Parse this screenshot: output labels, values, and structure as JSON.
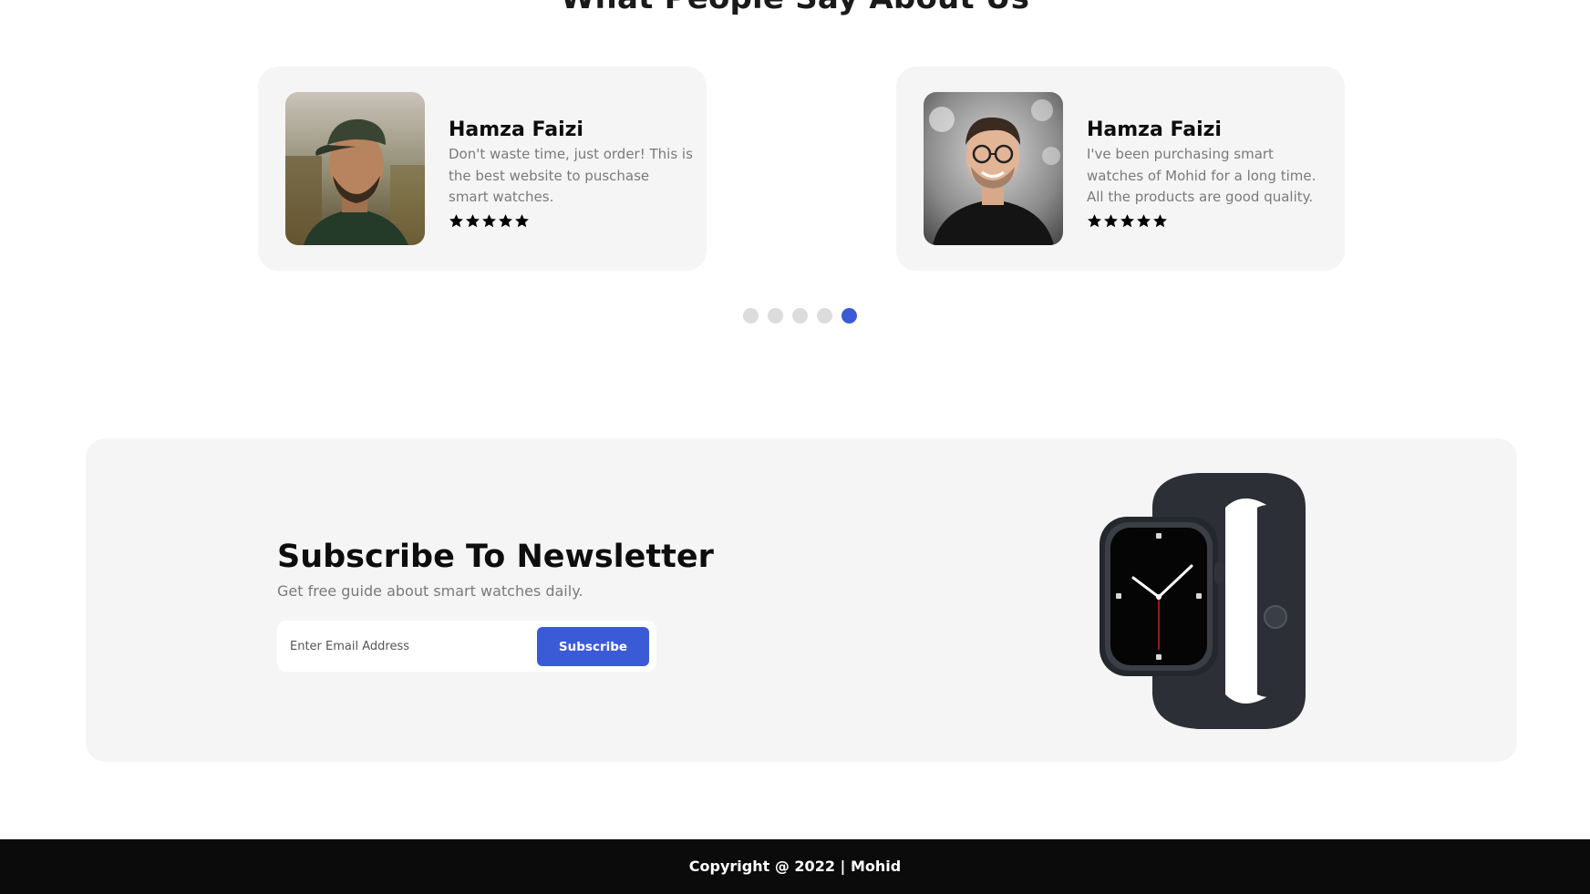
{
  "section": {
    "title": "What People Say About Us"
  },
  "testimonials": [
    {
      "name": "Hamza Faizi",
      "text": "Don't waste time, just order! This is the best website to puschase smart watches.",
      "rating": 5
    },
    {
      "name": "Hamza Faizi",
      "text": "I've been purchasing smart watches of Mohid for a long time. All the products are good quality.",
      "rating": 5
    }
  ],
  "carousel": {
    "dot_count": 5,
    "active_index": 4,
    "active_color": "#3b5bd6",
    "inactive_color": "#dcdcdc"
  },
  "newsletter": {
    "title": "Subscribe To Newsletter",
    "subtitle": "Get free guide about smart watches daily.",
    "input_placeholder": "Enter Email Address",
    "input_value": "",
    "button_label": "Subscribe",
    "image": "smart-watch-image"
  },
  "footer": {
    "copyright": "Copyright @ 2022 | Mohid"
  },
  "colors": {
    "accent": "#3b5bd6",
    "card_bg": "#f5f5f5",
    "footer_bg": "#0b0b0b"
  }
}
